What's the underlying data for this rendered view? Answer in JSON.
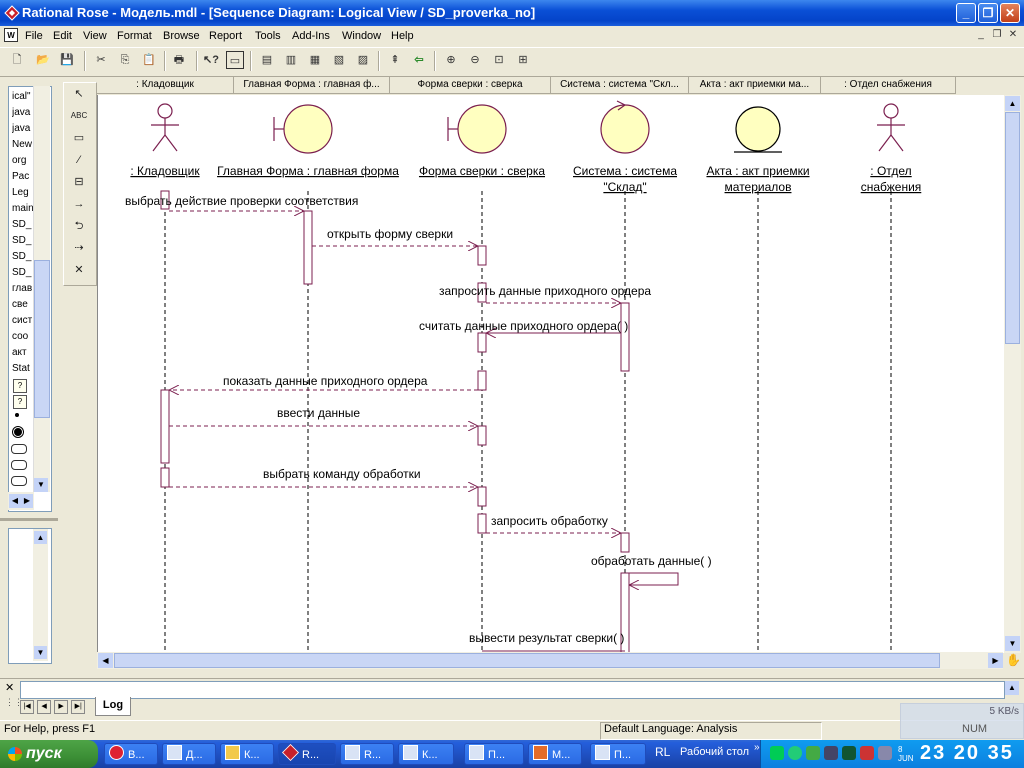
{
  "window": {
    "title": "Rational Rose - Модель.mdl - [Sequence Diagram: Logical View / SD_proverka_no]",
    "buttons": {
      "minimize": "_",
      "restore": "❐",
      "close": "✕"
    }
  },
  "menu": {
    "items": [
      "File",
      "Edit",
      "View",
      "Format",
      "Browse",
      "Report",
      "Tools",
      "Add-Ins",
      "Window",
      "Help"
    ],
    "mdi": {
      "minimize": "_",
      "restore": "❐",
      "close": "✕"
    }
  },
  "toolbar": {
    "icons": [
      "new-icon",
      "open-icon",
      "save-icon",
      "cut-icon",
      "copy-icon",
      "paste-icon",
      "print-icon",
      "context-help-icon",
      "view-doc-icon",
      "browse-class-icon",
      "browse-interaction-icon",
      "browse-component-icon",
      "browse-deployment-icon",
      "browse-state-icon",
      "parent-icon",
      "previous-icon",
      "zoom-in-icon",
      "zoom-out-icon",
      "fit-window-icon",
      "undo-fit-icon"
    ]
  },
  "browser": {
    "items": [
      "ical\"",
      "java",
      "java",
      "New",
      "org",
      "Pac",
      "Leg",
      "main",
      "SD_",
      "SD_",
      "SD_",
      "SD_",
      "глав",
      "све",
      "сист",
      "соо",
      "акт",
      "Stat"
    ]
  },
  "toolbox": {
    "icons": [
      "selection-tool-icon",
      "text-box-icon",
      "note-icon",
      "anchor-note-icon",
      "object-icon",
      "object-message-icon",
      "message-to-self-icon",
      "return-message-icon",
      "destruction-marker-icon"
    ],
    "text_label": "ABC"
  },
  "diagram": {
    "column_headers": [
      ": Кладовщик",
      "Главная Форма : главная ф...",
      "Форма сверки : сверка",
      "Система : система \"Скл...",
      "Акта : акт приемки ма...",
      ": Отдел снабжения"
    ],
    "objects": [
      {
        "lines": [
          ": Кладовщик"
        ],
        "kind": "actor"
      },
      {
        "lines": [
          "Главная Форма : главная форма"
        ],
        "kind": "boundary"
      },
      {
        "lines": [
          "Форма сверки : сверка"
        ],
        "kind": "boundary"
      },
      {
        "lines": [
          "Система : система",
          "\"Склад\""
        ],
        "kind": "control"
      },
      {
        "lines": [
          "Акта : акт приемки",
          "материалов"
        ],
        "kind": "entity"
      },
      {
        "lines": [
          ": Отдел",
          "снабжения"
        ],
        "kind": "actor"
      }
    ],
    "messages": [
      "выбрать действие проверки соответствия",
      "открыть форму сверки",
      "запросить данные приходного ордера",
      "считать данные приходного ордера( )",
      "показать данные приходного ордера",
      "ввести данные",
      "выбрать команду обработки",
      "запросить обработку",
      "обработать данные( )",
      "вывести результат сверки( )"
    ]
  },
  "log": {
    "tab_label": "Log"
  },
  "status": {
    "help": "For Help, press F1",
    "language": "Default Language: Analysis",
    "num": "NUM",
    "net_speed": "5 KB/s"
  },
  "taskbar": {
    "start_label": "пуск",
    "tasks": [
      "В...",
      "Д...",
      "К...",
      "R...",
      "R...",
      "К...",
      "П...",
      "М...",
      "П..."
    ],
    "quicklaunch_label": "RL",
    "desktop_label": "Рабочий стол",
    "clock": "23 20 35",
    "clock_sub": "JUN",
    "clock_day": "8"
  }
}
